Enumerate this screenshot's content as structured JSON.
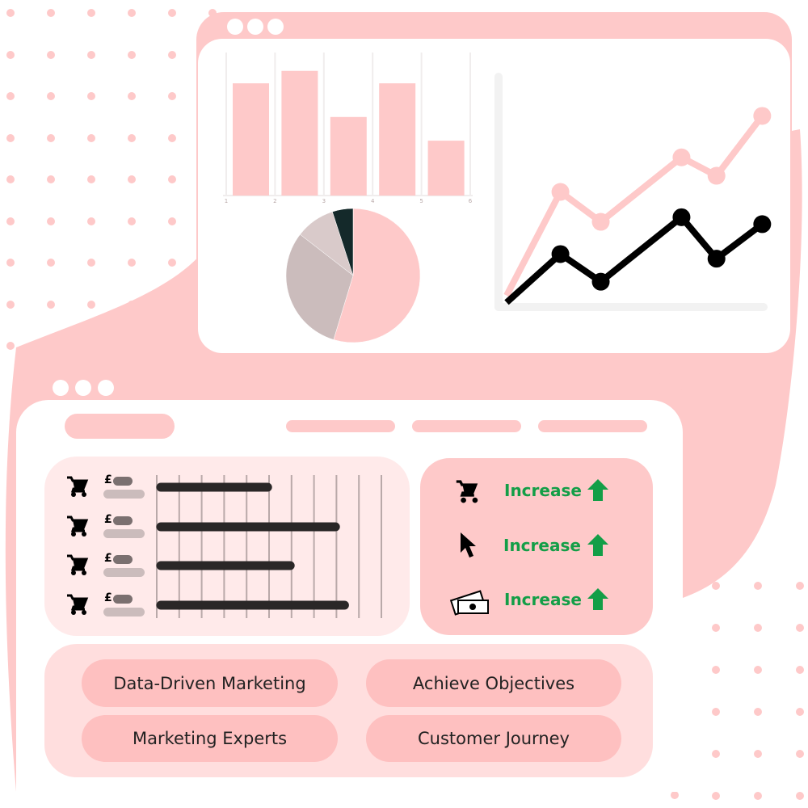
{
  "colors": {
    "pink": "#fec9c9",
    "light_pink": "#ffeaea",
    "card_pink": "#ffdede",
    "tag_pink": "#fec0c0",
    "green": "#139e47",
    "dark": "#2a2727",
    "black": "#000000"
  },
  "chart_data": [
    {
      "type": "bar",
      "categories": [
        "1",
        "2",
        "3",
        "4",
        "5"
      ],
      "tick_labels": [
        "1",
        "2",
        "3",
        "4",
        "5",
        "6"
      ],
      "values": [
        0.9,
        1.0,
        0.63,
        0.9,
        0.44
      ],
      "ylim": [
        0,
        1.05
      ],
      "grid": true,
      "color": "#fec9c9"
    },
    {
      "type": "pie",
      "values": [
        54.7,
        30.8,
        9.5,
        5.0
      ],
      "colors": [
        "#fec9c9",
        "#cbbcbc",
        "#d9caca",
        "#14292a"
      ]
    },
    {
      "type": "line",
      "x": [
        3,
        23,
        38,
        68,
        81,
        98
      ],
      "series": [
        {
          "values": [
            5,
            50,
            37,
            65,
            57,
            83
          ],
          "color": "#fec9c9"
        },
        {
          "values": [
            2,
            23,
            11,
            39,
            21,
            36
          ],
          "color": "#000000"
        }
      ],
      "xlim": [
        0,
        100
      ],
      "ylim": [
        0,
        100
      ]
    }
  ],
  "spend_panel": {
    "currency_symbol": "£",
    "rows": [
      {
        "icon": "cart-icon",
        "value": 0.49
      },
      {
        "icon": "cart-icon",
        "value": 0.79
      },
      {
        "icon": "cart-icon",
        "value": 0.59
      },
      {
        "icon": "cart-icon",
        "value": 0.83
      }
    ]
  },
  "metrics": [
    {
      "icon": "cart-icon",
      "label": "Increase",
      "trend": "arrow-up-icon"
    },
    {
      "icon": "cursor-icon",
      "label": "Increase",
      "trend": "arrow-up-icon"
    },
    {
      "icon": "money-icon",
      "label": "Increase",
      "trend": "arrow-up-icon"
    }
  ],
  "tags": [
    "Data-Driven Marketing",
    "Achieve Objectives",
    "Marketing Experts",
    "Customer Journey"
  ]
}
